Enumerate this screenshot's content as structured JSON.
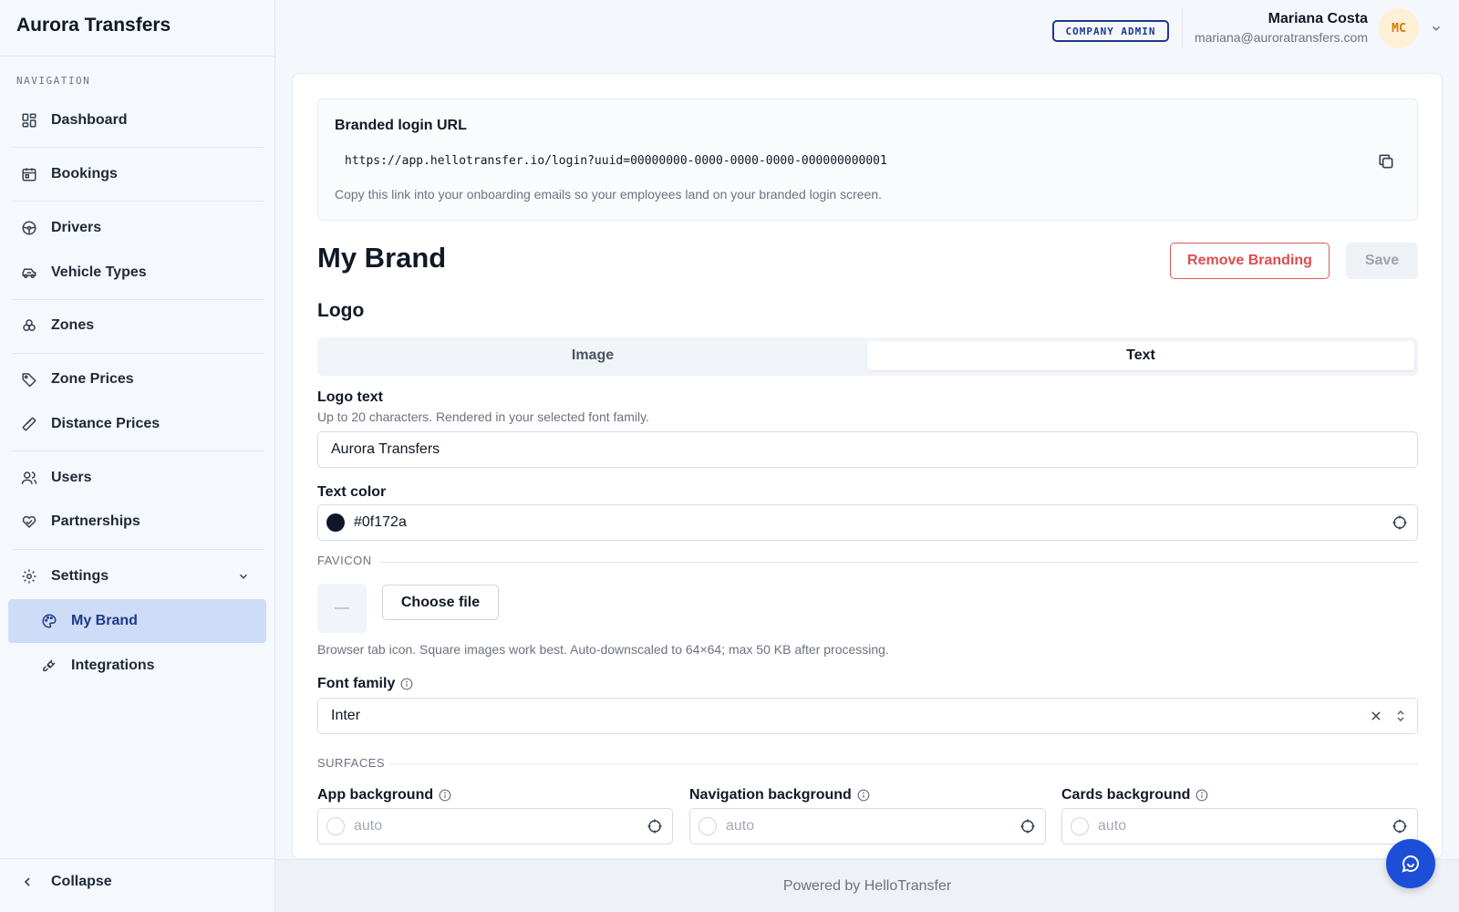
{
  "app": {
    "brand": "Aurora Transfers"
  },
  "sidebar": {
    "heading": "NAVIGATION",
    "items": [
      {
        "label": "Dashboard",
        "icon": "dashboard-icon"
      },
      {
        "label": "Bookings",
        "icon": "calendar-icon"
      },
      {
        "label": "Drivers",
        "icon": "steering-wheel-icon"
      },
      {
        "label": "Vehicle Types",
        "icon": "car-icon"
      },
      {
        "label": "Zones",
        "icon": "zones-icon"
      },
      {
        "label": "Zone Prices",
        "icon": "tag-icon"
      },
      {
        "label": "Distance Prices",
        "icon": "ruler-icon"
      },
      {
        "label": "Users",
        "icon": "users-icon"
      },
      {
        "label": "Partnerships",
        "icon": "handshake-heart-icon"
      },
      {
        "label": "Settings",
        "icon": "gear-icon"
      }
    ],
    "settings_children": [
      {
        "label": "My Brand",
        "icon": "palette-icon",
        "active": true
      },
      {
        "label": "Integrations",
        "icon": "plug-icon",
        "active": false
      }
    ],
    "collapse_label": "Collapse"
  },
  "topbar": {
    "role_badge": "COMPANY ADMIN",
    "user_name": "Mariana Costa",
    "user_email": "mariana@auroratransfers.com",
    "avatar_initials": "MC"
  },
  "login_url": {
    "title": "Branded login URL",
    "value": "https://app.hellotransfer.io/login?uuid=00000000-0000-0000-0000-000000000001",
    "help": "Copy this link into your onboarding emails so your employees land on your branded login screen."
  },
  "page": {
    "title": "My Brand",
    "remove_button": "Remove Branding",
    "save_button": "Save"
  },
  "logo": {
    "heading": "Logo",
    "tabs": [
      "Image",
      "Text"
    ],
    "selected_tab": "Text",
    "text_label": "Logo text",
    "text_hint": "Up to 20 characters. Rendered in your selected font family.",
    "text_value": "Aurora Transfers",
    "color_label": "Text color",
    "color_value": "#0f172a"
  },
  "favicon": {
    "section_label": "FAVICON",
    "preview_placeholder": "—",
    "choose_button": "Choose file",
    "hint": "Browser tab icon. Square images work best. Auto-downscaled to 64×64; max 50 KB after processing."
  },
  "font": {
    "label": "Font family",
    "value": "Inter"
  },
  "surfaces": {
    "section_label": "SURFACES",
    "fields": [
      {
        "label": "App background",
        "placeholder": "auto"
      },
      {
        "label": "Navigation background",
        "placeholder": "auto"
      },
      {
        "label": "Cards background",
        "placeholder": "auto"
      }
    ]
  },
  "footer": {
    "text": "Powered by HelloTransfer"
  },
  "colors": {
    "accent": "#1d4ed8",
    "active_nav_bg": "#cfdcf7",
    "danger": "#dc4d4d",
    "text_swatch": "#0f172a"
  }
}
